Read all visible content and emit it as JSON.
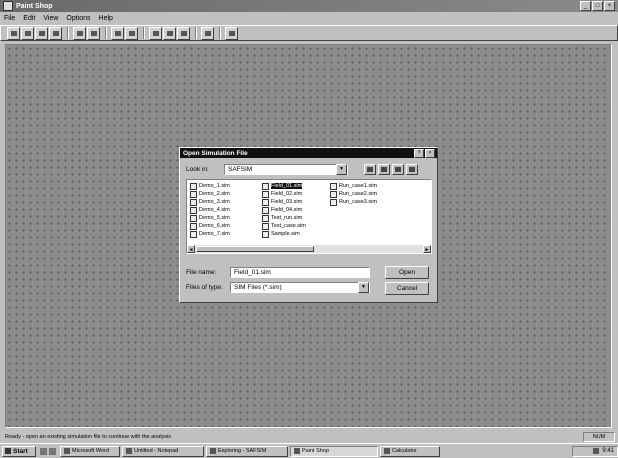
{
  "window": {
    "title": "Paint Shop",
    "controls": {
      "minimize": "_",
      "maximize": "□",
      "close": "×"
    }
  },
  "menu": [
    "File",
    "Edit",
    "View",
    "Options",
    "Help"
  ],
  "dialog": {
    "title": "Open Simulation File",
    "look_in_label": "Look in:",
    "look_in_value": "SAFSIM",
    "files_col1": [
      "Demo_1.sim",
      "Demo_2.sim",
      "Demo_3.sim",
      "Demo_4.sim",
      "Demo_5.sim",
      "Demo_6.sim",
      "Demo_7.sim"
    ],
    "files_col2": [
      "Field_01.sim",
      "Field_02.sim",
      "Field_03.sim",
      "Field_04.sim",
      "Test_run.sim",
      "Test_case.sim",
      "Sample.sim"
    ],
    "files_col3": [
      "Run_case1.sim",
      "Run_case2.sim",
      "Run_case3.sim"
    ],
    "selected_file": "Field_01.sim",
    "filename_label": "File name:",
    "filename_value": "Field_01.sim",
    "filetype_label": "Files of type:",
    "filetype_value": "SIM Files (*.sim)",
    "open_button": "Open",
    "cancel_button": "Cancel"
  },
  "statusbar": {
    "text": "Ready - open an existing simulation file to continue with the analysis",
    "indicator": "NUM"
  },
  "taskbar": {
    "start": "Start",
    "tasks": [
      {
        "label": "Microsoft Word",
        "active": false
      },
      {
        "label": "Untitled - Notepad",
        "active": false
      },
      {
        "label": "Exploring - SAFSIM",
        "active": false
      },
      {
        "label": "Paint Shop",
        "active": true
      },
      {
        "label": "Calculator",
        "active": false
      }
    ],
    "clock": "9:41"
  }
}
